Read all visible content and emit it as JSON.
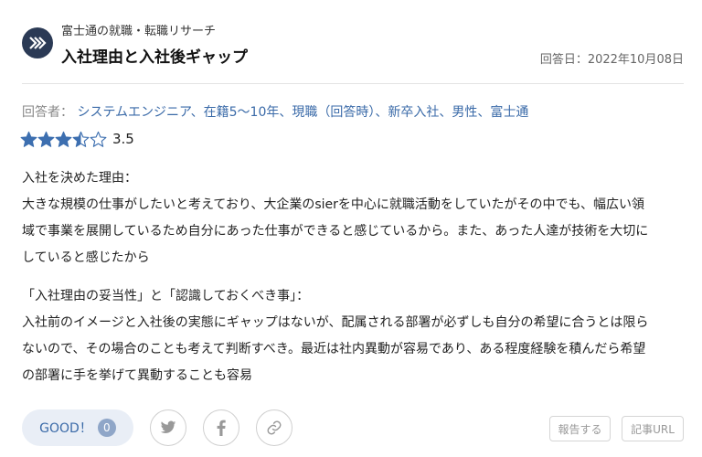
{
  "header": {
    "subtitle": "富士通の就職・転職リサーチ",
    "title": "入社理由と入社後ギャップ",
    "date": "回答日：2022年10月08日"
  },
  "respondent": {
    "label": "回答者：",
    "value": "システムエンジニア、在籍5〜10年、現職（回答時）、新卒入社、男性、富士通"
  },
  "rating": {
    "score": "3.5",
    "value": 3.5,
    "max": 5,
    "star_color": "#3d6fb0"
  },
  "sections": [
    {
      "heading": "入社を決めた理由：",
      "lines": [
        "大きな規模の仕事がしたいと考えており、大企業のsierを中心に就職活動をしていたがその中でも、幅広い領",
        "域で事業を展開しているため自分にあった仕事ができると感じているから。また、あった人達が技術を大切に",
        "していると感じたから"
      ]
    },
    {
      "heading": "「入社理由の妥当性」と「認識しておくべき事」：",
      "lines": [
        "入社前のイメージと入社後の実態にギャップはないが、配属される部署が必ずしも自分の希望に合うとは限ら",
        "ないので、その場合のことも考えて判断すべき。最近は社内異動が容易であり、ある程度経験を積んだら希望",
        "の部署に手を挙げて異動することも容易"
      ]
    }
  ],
  "footer": {
    "good_label": "GOOD！",
    "good_count": "0",
    "report_label": "報告する",
    "url_label": "記事URL"
  },
  "icons": {
    "logo": "chevrons-right-icon",
    "twitter": "twitter-icon",
    "facebook": "facebook-icon",
    "link": "link-icon"
  }
}
